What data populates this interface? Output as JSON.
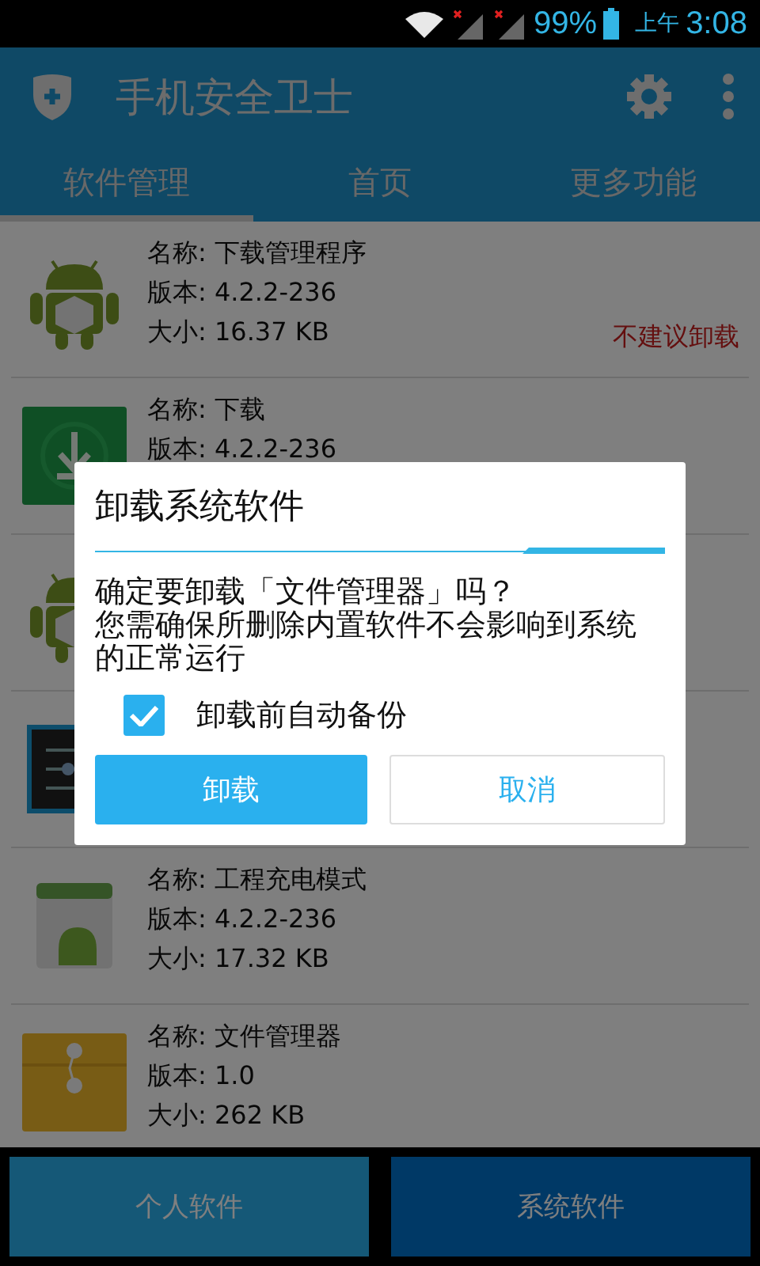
{
  "status_bar": {
    "battery": "99%",
    "time_prefix": "上午",
    "time": "3:08"
  },
  "app_bar": {
    "title": "手机安全卫士"
  },
  "tabs": [
    {
      "label": "软件管理",
      "selected": true
    },
    {
      "label": "首页",
      "selected": false
    },
    {
      "label": "更多功能",
      "selected": false
    }
  ],
  "apps": [
    {
      "kind": "android",
      "lines": [
        "名称: 下载管理程序",
        "版本: 4.2.2-236",
        "大小: 16.37 KB"
      ],
      "warning": "不建议卸载"
    },
    {
      "kind": "download",
      "lines": [
        "名称: 下载",
        "版本: 4.2.2-236"
      ]
    },
    {
      "kind": "android"
    },
    {
      "kind": "settings"
    },
    {
      "kind": "android-card",
      "lines": [
        "名称: 工程充电模式",
        "版本: 4.2.2-236",
        "大小: 17.32 KB"
      ]
    },
    {
      "kind": "folder",
      "lines": [
        "名称: 文件管理器",
        "版本: 1.0",
        "大小: 262 KB"
      ]
    }
  ],
  "dialog": {
    "title": "卸载系统软件",
    "message": [
      "确定要卸载「文件管理器」吗？",
      "您需确保所删除内置软件不会影响到系统的正常运行"
    ],
    "checkbox": {
      "label": "卸载前自动备份",
      "checked": true
    },
    "buttons": [
      {
        "label": "卸载",
        "kind": "primary"
      },
      {
        "label": "取消",
        "kind": "secondary"
      }
    ]
  },
  "bottom_tabs": [
    {
      "label": "个人软件",
      "selected": false
    },
    {
      "label": "系统软件",
      "selected": true
    }
  ]
}
